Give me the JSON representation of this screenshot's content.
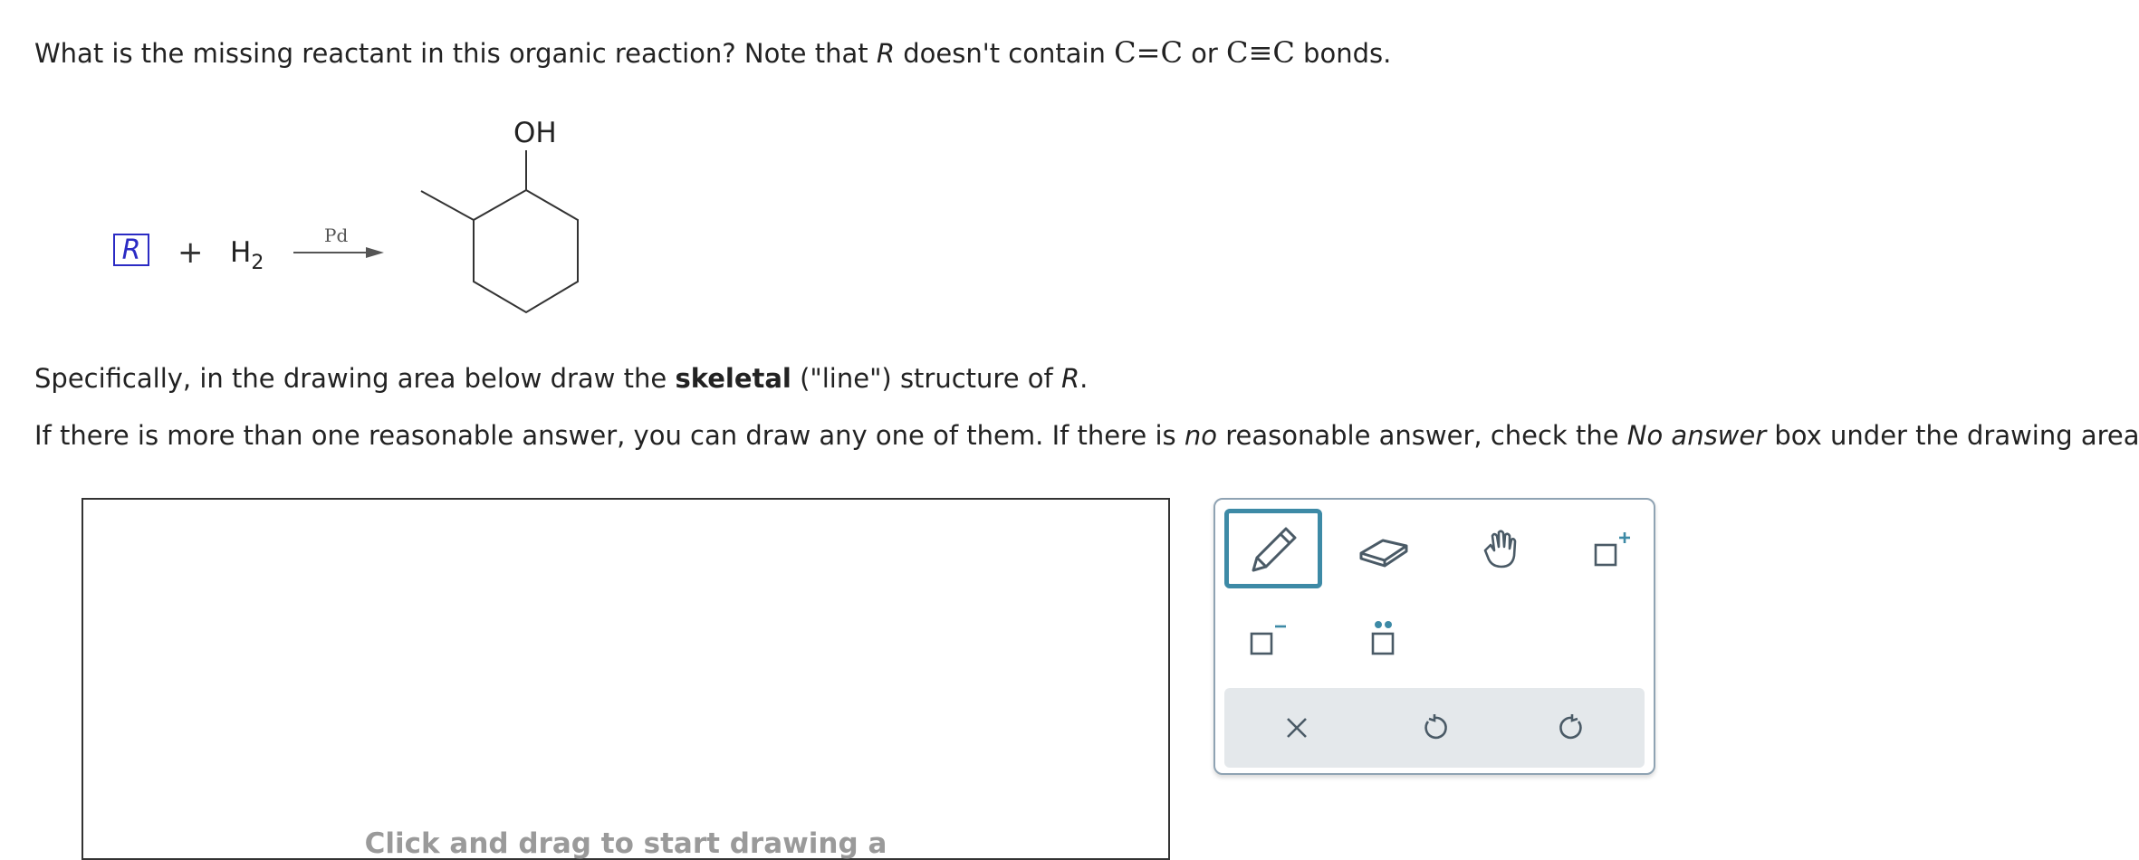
{
  "question": {
    "prefix": "What is the missing reactant in this organic reaction? Note that",
    "r_italic": "R",
    "middle": "doesn't contain",
    "double_bond": "C=C",
    "or_word": "or",
    "triple_bond": "C≡C",
    "suffix": "bonds."
  },
  "reaction": {
    "reactant_label": "R",
    "plus": "+",
    "h2_main": "H",
    "h2_sub": "2",
    "catalyst": "Pd",
    "product_group": "OH"
  },
  "instructions": {
    "line1_prefix": "Specifically, in the drawing area below draw the",
    "line1_bold": "skeletal",
    "line1_middle": "(\"line\") structure of",
    "line1_r": "R",
    "line1_end": ".",
    "line2_a": "If there is more than one reasonable answer, you can draw any one of them. If there is",
    "line2_no": "no",
    "line2_b": "reasonable answer, check the",
    "line2_noanswer": "No answer",
    "line2_c": "box under the drawing area."
  },
  "canvas": {
    "hint": "Click and drag to start drawing a"
  },
  "toolbar": {
    "tools": [
      "pencil-icon",
      "eraser-icon",
      "hand-icon",
      "increase-charge-icon",
      "decrease-charge-icon",
      "lone-pair-icon"
    ],
    "actions": [
      "clear-icon",
      "undo-icon",
      "redo-icon"
    ],
    "accent": "#3d8aa6"
  }
}
